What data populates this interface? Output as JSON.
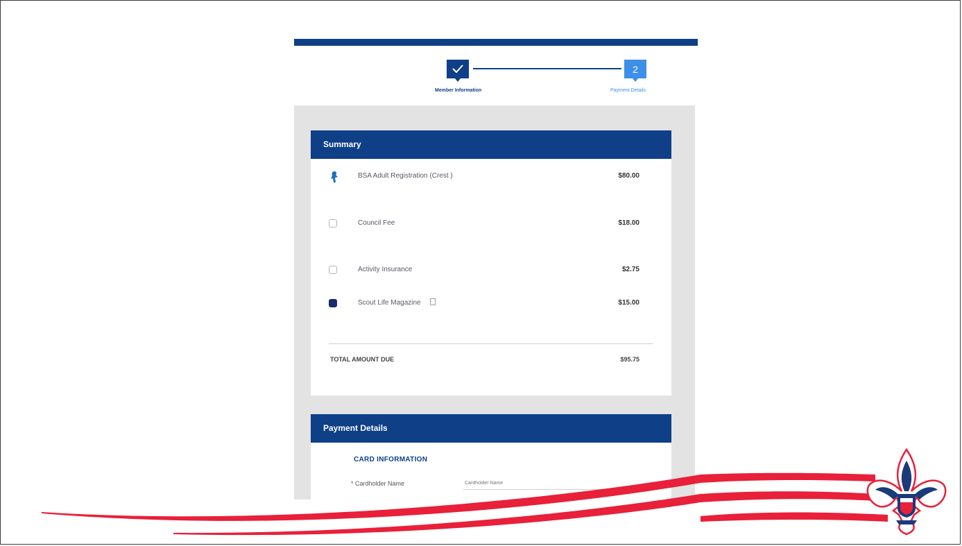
{
  "progress": {
    "steps": [
      {
        "label": "Member Information"
      },
      {
        "label": "Payment Details",
        "number": "2"
      }
    ]
  },
  "summary": {
    "title": "Summary",
    "items": [
      {
        "name": "BSA Adult Registration (Crest )",
        "sub1": "",
        "sub2": "",
        "price": "$80.00"
      },
      {
        "name": "Council Fee",
        "sub1": "",
        "sub2": "",
        "price": "$18.00"
      },
      {
        "name": "Activity Insurance",
        "price": "$2.75"
      },
      {
        "name": "Scout Life Magazine",
        "sub1": "",
        "sub2": "",
        "price": "$15.00"
      }
    ],
    "total_label": "TOTAL AMOUNT DUE",
    "total_value": "$95.75"
  },
  "payment": {
    "title": "Payment Details",
    "section": "CARD INFORMATION",
    "cardholder_label": "* Cardholder Name",
    "cardholder_placeholder": "Cardholder Name"
  },
  "colors": {
    "brand_blue": "#0e3f87",
    "accent_blue": "#3d8fe8",
    "swoosh_red": "#e8203a",
    "panel_gray": "#e3e3e3"
  }
}
